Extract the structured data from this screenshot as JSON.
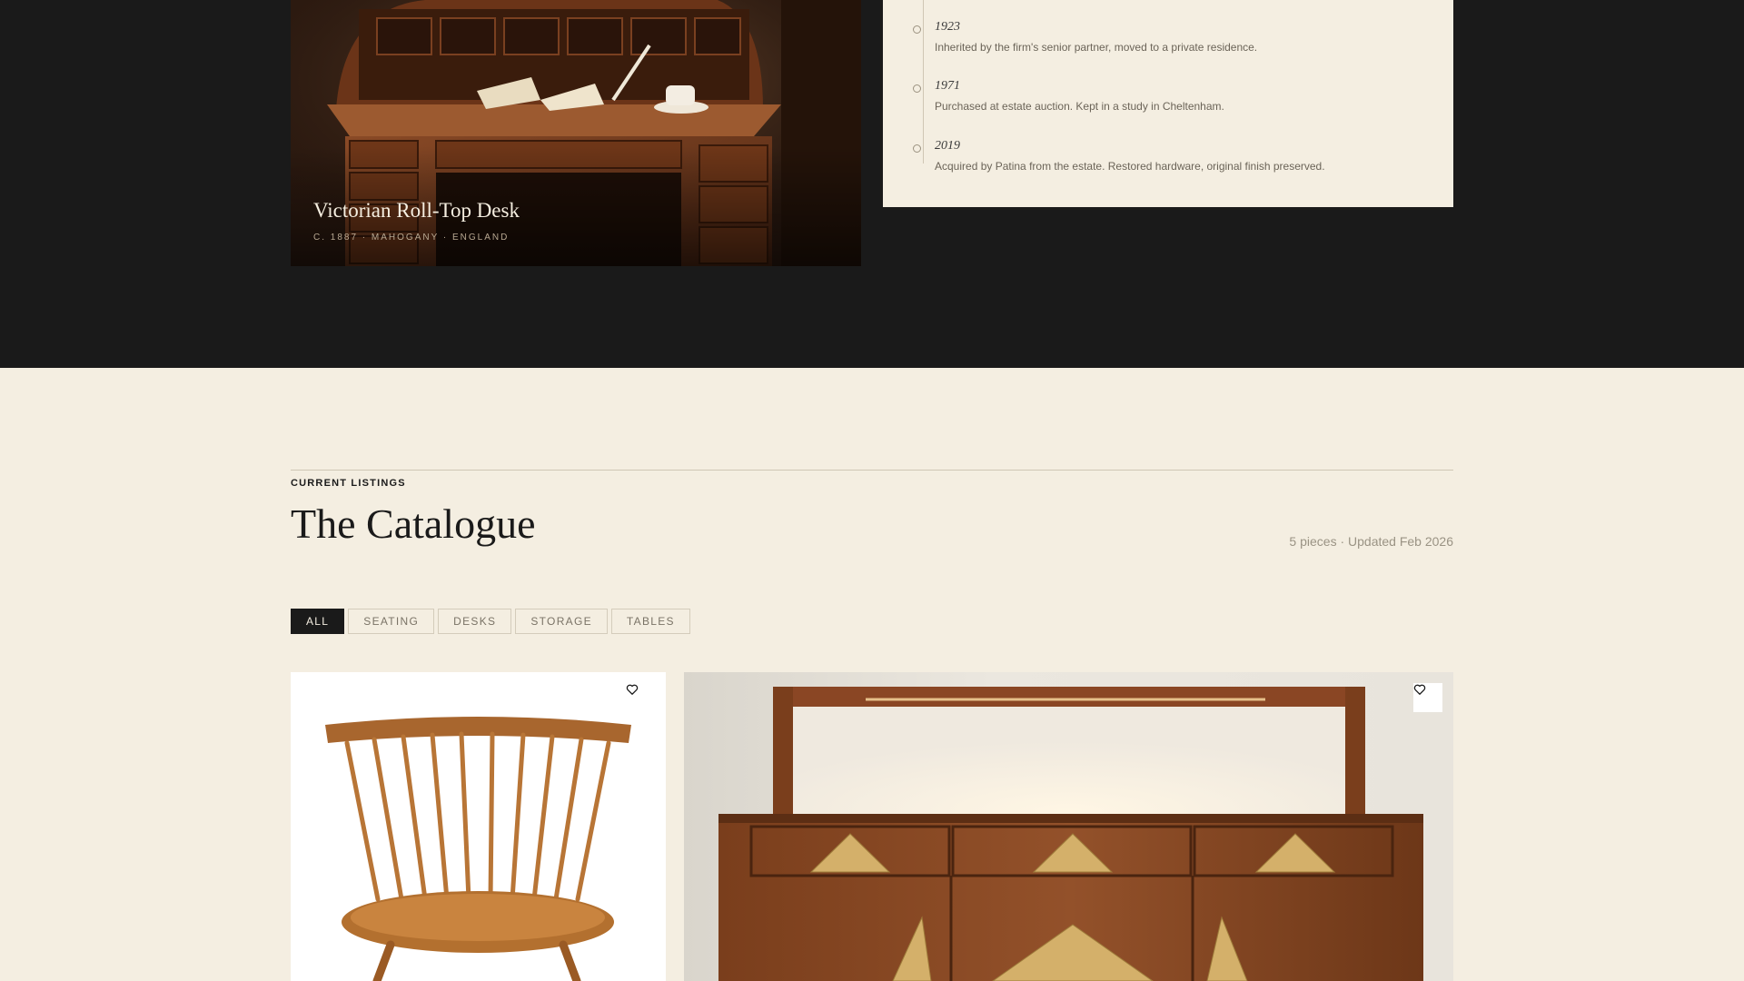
{
  "feature": {
    "title": "Victorian Roll-Top Desk",
    "meta": "C. 1887 · MAHOGANY · ENGLAND"
  },
  "provenance": [
    {
      "year": "1923",
      "text": "Inherited by the firm's senior partner, moved to a private residence."
    },
    {
      "year": "1971",
      "text": "Purchased at estate auction. Kept in a study in Cheltenham."
    },
    {
      "year": "2019",
      "text": "Acquired by Patina from the estate. Restored hardware, original finish preserved."
    }
  ],
  "catalogue": {
    "eyebrow": "CURRENT LISTINGS",
    "title": "The Catalogue",
    "meta": "5 pieces · Updated Feb 2026",
    "filters": [
      "ALL",
      "SEATING",
      "DESKS",
      "STORAGE",
      "TABLES"
    ],
    "active_filter": "ALL"
  },
  "colors": {
    "dark": "#1a1a1a",
    "cream": "#f4eee1",
    "mahogany": "#5a3620",
    "brass": "#c9a45a"
  },
  "icons": {
    "favorite": "heart-outline-icon"
  }
}
